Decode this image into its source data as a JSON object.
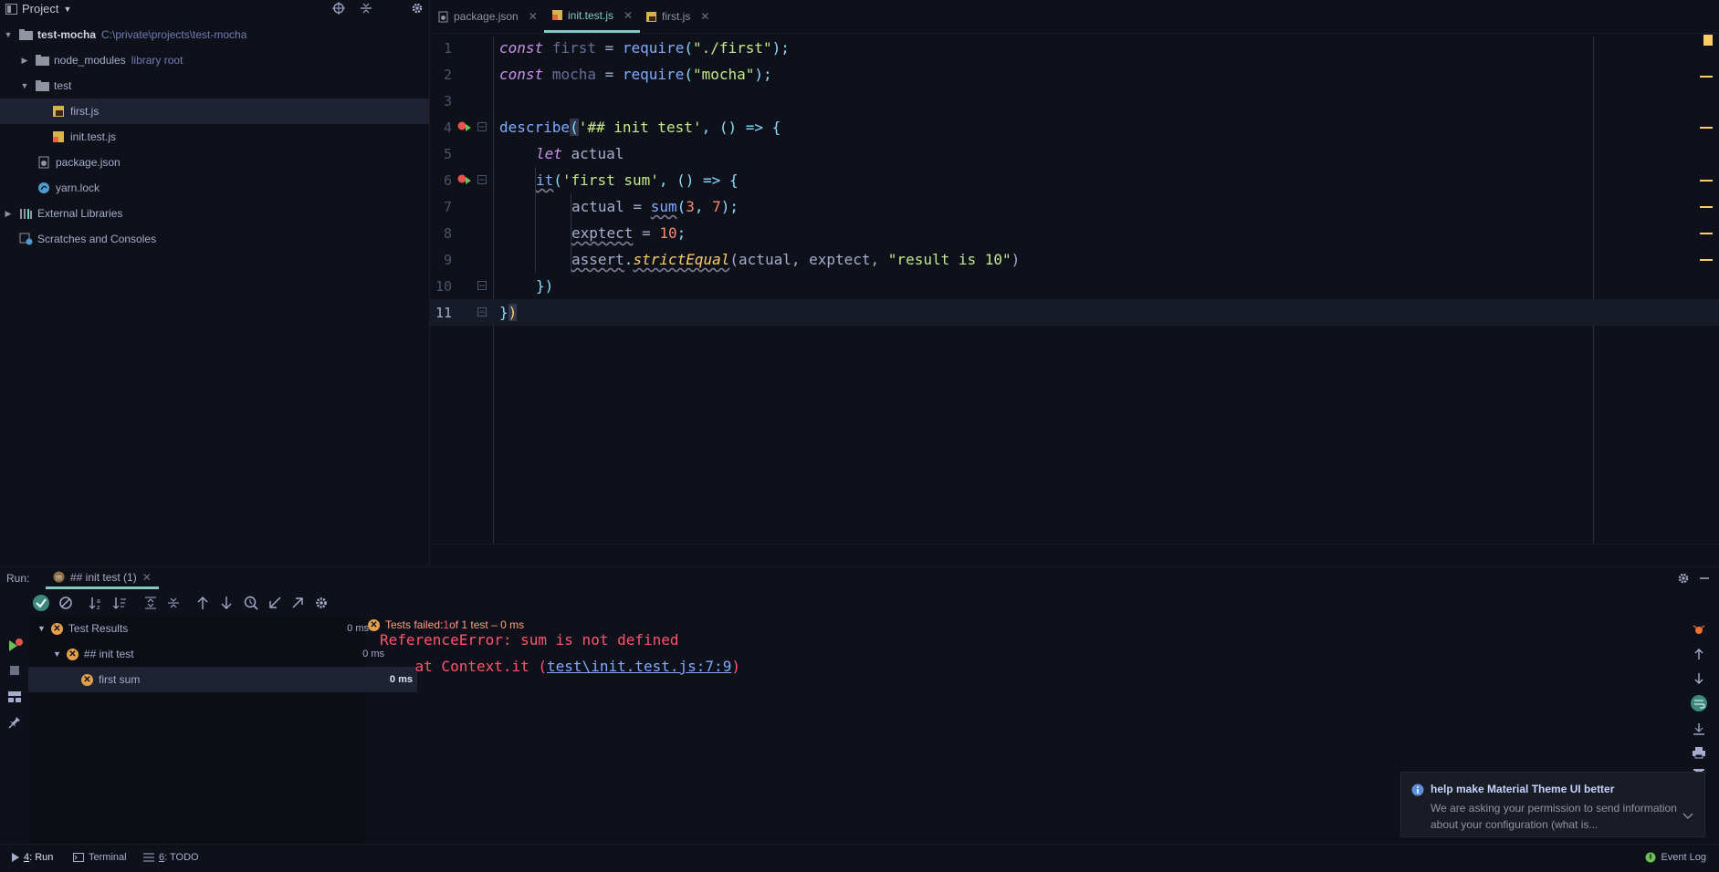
{
  "project": {
    "header_label": "Project",
    "tree": [
      {
        "label": "test-mocha",
        "sub": "C:\\private\\projects\\test-mocha"
      },
      {
        "label": "node_modules",
        "sub": "library root"
      },
      {
        "label": "test"
      },
      {
        "label": "first.js"
      },
      {
        "label": "init.test.js"
      },
      {
        "label": "package.json"
      },
      {
        "label": "yarn.lock"
      },
      {
        "label": "External Libraries"
      },
      {
        "label": "Scratches and Consoles"
      }
    ]
  },
  "tabs": [
    {
      "label": "package.json"
    },
    {
      "label": "init.test.js"
    },
    {
      "label": "first.js"
    }
  ],
  "code": {
    "line_numbers": [
      "1",
      "2",
      "3",
      "4",
      "5",
      "6",
      "7",
      "8",
      "9",
      "10",
      "11"
    ],
    "l1": {
      "kw": "const",
      "var": "first",
      "eq": " = ",
      "fn": "require",
      "p1": "(",
      "str": "\"./first\"",
      "p2": ");"
    },
    "l2": {
      "kw": "const",
      "var": "mocha",
      "eq": " = ",
      "fn": "require",
      "p1": "(",
      "str": "\"mocha\"",
      "p2": ");"
    },
    "l4": {
      "fn": "describe",
      "p1": "(",
      "str": "'## init test'",
      "rest": ", () => {"
    },
    "l5": {
      "kw": "let",
      "var": " actual"
    },
    "l6": {
      "fn": "it",
      "p1": "(",
      "str": "'first sum'",
      "rest": ", () => {"
    },
    "l7": {
      "a": "actual = ",
      "fn": "sum",
      "p1": "(",
      "n1": "3",
      "c": ", ",
      "n2": "7",
      "p2": ");"
    },
    "l8": {
      "a": "exptect",
      "b": " = ",
      "n": "10",
      "c": ";"
    },
    "l9": {
      "a": "assert",
      "dot": ".",
      "m": "strictEqual",
      "args": "(actual, exptect, ",
      "str": "\"result is 10\"",
      "end": ")"
    },
    "l10": {
      "t": "})"
    },
    "l11": {
      "t1": "}",
      "t2": ")"
    }
  },
  "run": {
    "label": "Run:",
    "tab_label": "## init test (1)",
    "status_prefix": "Tests failed: ",
    "status_count": "1",
    "status_suffix": " of 1 test – 0 ms",
    "results": [
      {
        "label": "Test Results",
        "time": "0 ms"
      },
      {
        "label": "## init test",
        "time": "0 ms"
      },
      {
        "label": "first sum",
        "time": "0 ms"
      }
    ],
    "console": {
      "line1": "ReferenceError: sum is not defined",
      "line2_prefix": "    at Context.it (",
      "line2_link": "test\\init.test.js:7:9",
      "line2_suffix": ")"
    }
  },
  "notification": {
    "title": "help make Material Theme UI better",
    "body": "We are asking your permission to send information about your configuration (what is..."
  },
  "statusbar": {
    "run_num": "4",
    "run_label": ": Run",
    "terminal": "Terminal",
    "todo_num": "6",
    "todo_label": ": TODO",
    "event_log": "Event Log"
  },
  "colors": {
    "background": "#0f111a",
    "accent": "#80cbc4",
    "error": "#ff5370",
    "fail_icon": "#e5a04c"
  }
}
